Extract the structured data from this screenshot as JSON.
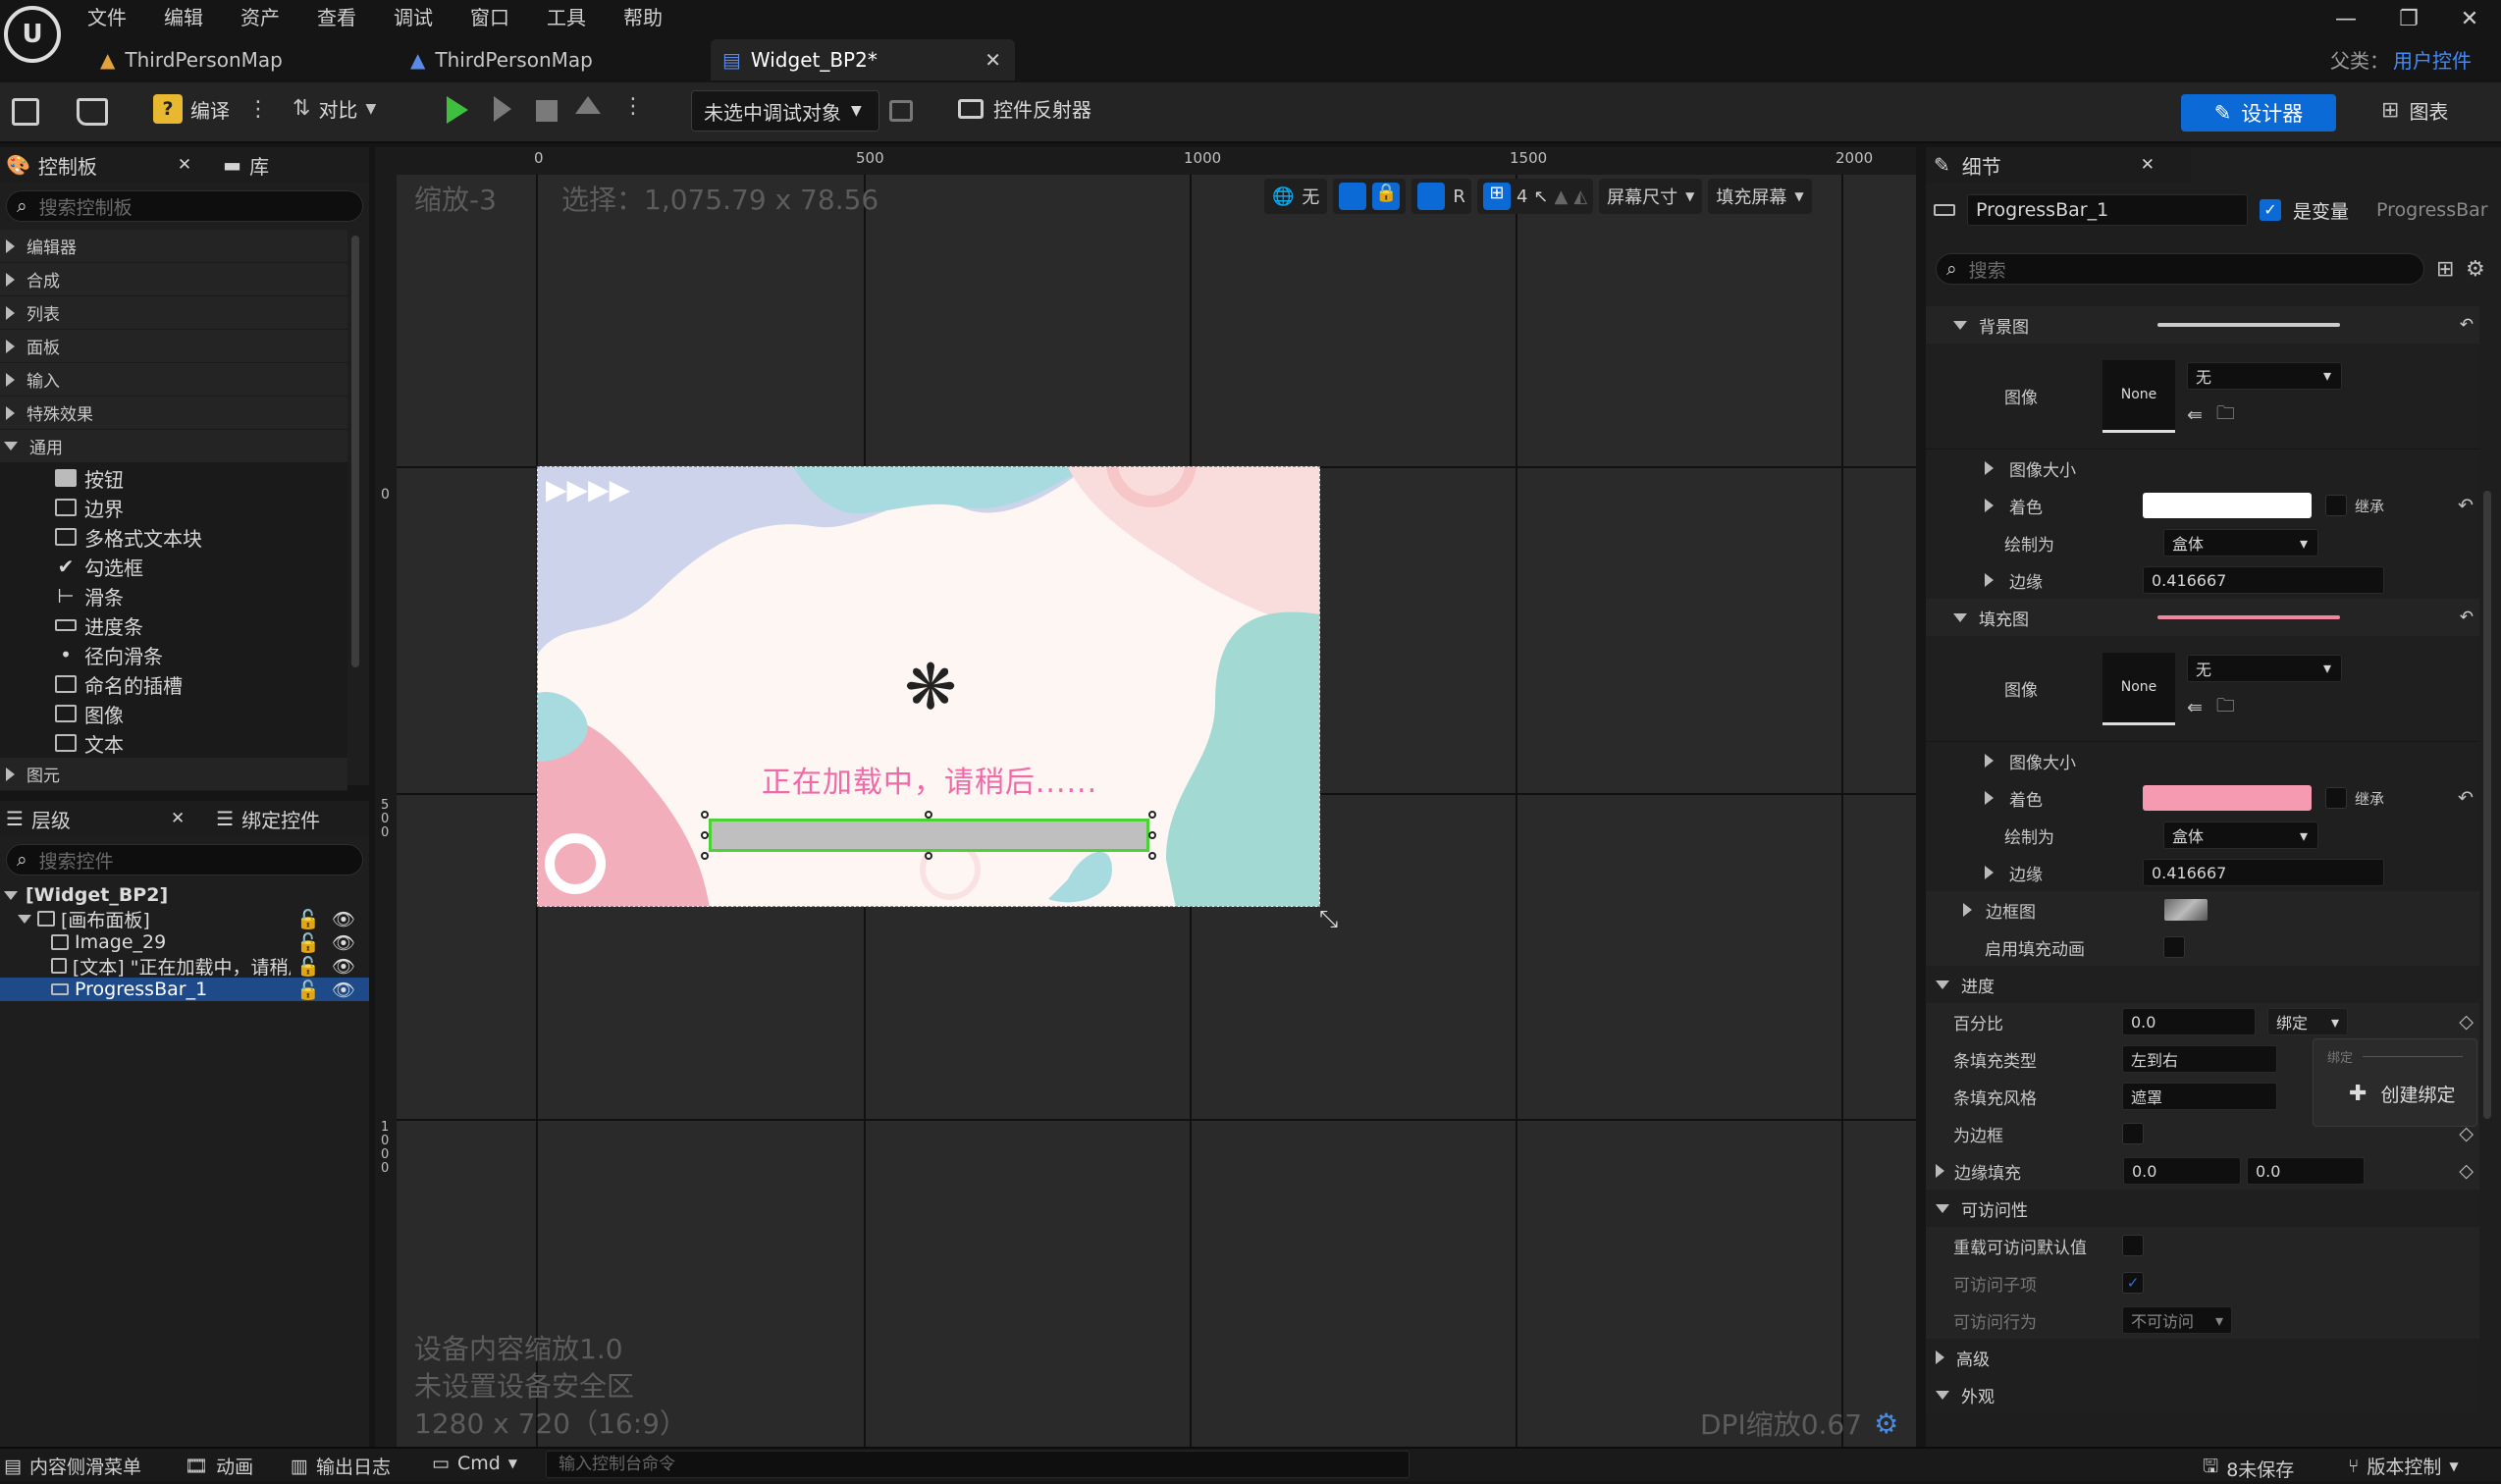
{
  "menu": [
    "文件",
    "编辑",
    "资产",
    "查看",
    "调试",
    "窗口",
    "工具",
    "帮助"
  ],
  "tabs": [
    {
      "label": "ThirdPersonMap"
    },
    {
      "label": "ThirdPersonMap"
    },
    {
      "label": "Widget_BP2*"
    }
  ],
  "parent_class": {
    "label": "父类：",
    "value": "用户控件"
  },
  "toolbar": {
    "compile": "编译",
    "diff": "对比",
    "debug_target": "未选中调试对象",
    "reflector": "控件反射器",
    "designer": "设计器",
    "graph": "图表"
  },
  "palette": {
    "title": "控制板",
    "library": "库",
    "search_placeholder": "搜索控制板",
    "categories": [
      "编辑器",
      "合成",
      "列表",
      "面板",
      "输入",
      "特殊效果",
      "通用"
    ],
    "common_items": [
      "按钮",
      "边界",
      "多格式文本块",
      "勾选框",
      "滑条",
      "进度条",
      "径向滑条",
      "命名的插槽",
      "图像",
      "文本"
    ],
    "next_category": "图元"
  },
  "hierarchy": {
    "title": "层级",
    "bind": "绑定控件",
    "search_placeholder": "搜索控件",
    "items": [
      "[Widget_BP2]",
      "[画布面板]",
      "Image_29",
      "[文本] \"正在加载中，请稍后",
      "ProgressBar_1"
    ]
  },
  "viewport": {
    "zoom": "缩放-3",
    "selection": "选择：1,075.79 x 78.56",
    "ruler_x": [
      "0",
      "500",
      "1000",
      "1500",
      "2000"
    ],
    "ruler_y": [
      "0",
      "5\n0\n0",
      "1\n0\n0\n0"
    ],
    "tb_none": "无",
    "tb_r": "R",
    "tb_four": "4",
    "screen_size": "屏幕尺寸",
    "fill_screen": "填充屏幕",
    "loading_text": "正在加载中，请稍后......",
    "device_scale": "设备内容缩放1.0",
    "safe_zone": "未设置设备安全区",
    "resolution": "1280 x 720（16:9）",
    "dpi": "DPI缩放0.67",
    "progress_percent": 0.0
  },
  "details": {
    "title": "细节",
    "name": "ProgressBar_1",
    "is_variable": "是变量",
    "class_name": "ProgressBar",
    "search_placeholder": "搜索",
    "bg_section": "背景图",
    "image": "图像",
    "none": "None",
    "none_cn": "无",
    "image_size": "图像大小",
    "tint": "着色",
    "inherit": "继承",
    "draw_as": "绘制为",
    "box": "盒体",
    "margin": "边缘",
    "margin_val": "0.416667",
    "fill_section": "填充图",
    "border_image": "边框图",
    "enable_fill_anim": "启用填充动画",
    "progress_section": "进度",
    "percent": "百分比",
    "percent_val": "0.0",
    "bind": "绑定",
    "bar_fill_type": "条填充类型",
    "bar_fill_type_val": "左到右",
    "bar_fill_style": "条填充风格",
    "bar_fill_style_val": "遮罩",
    "is_marquee": "为边框",
    "border_padding": "边缘填充",
    "pad_x": "0.0",
    "pad_y": "0.0",
    "accessibility": "可访问性",
    "override_access": "重载可访问默认值",
    "access_children": "可访问子项",
    "access_behavior": "可访问行为",
    "access_behavior_val": "不可访问",
    "advanced": "高级",
    "appearance": "外观",
    "popup_header": "绑定",
    "create_binding": "创建绑定"
  },
  "statusbar": {
    "content_drawer": "内容侧滑菜单",
    "animation": "动画",
    "output_log": "输出日志",
    "cmd": "Cmd",
    "cmd_placeholder": "输入控制台命令",
    "unsaved": "8未保存",
    "source_control": "版本控制"
  },
  "colors": {
    "accent": "#0c6ad6",
    "fill_tint": "#f59ab0",
    "bg_tint": "#ffffff",
    "selection_green": "#4cd137"
  }
}
